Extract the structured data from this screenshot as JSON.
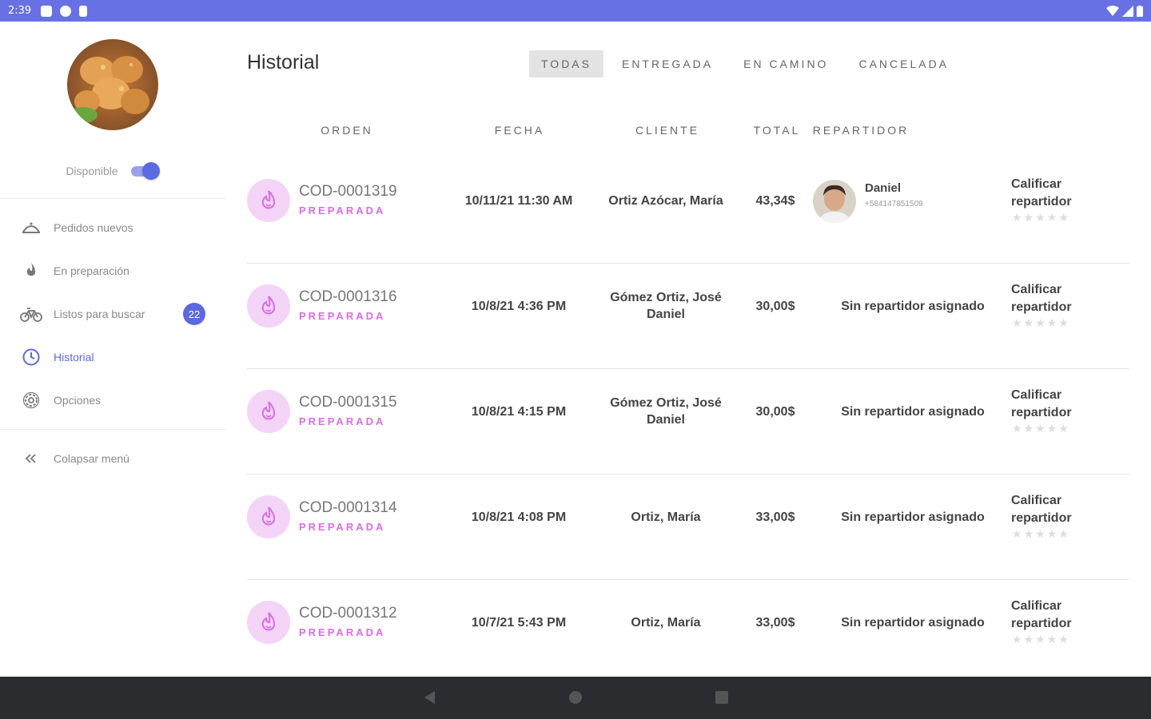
{
  "status_bar": {
    "time": "2:39"
  },
  "sidebar": {
    "availability_label": "Disponible",
    "availability_on": true,
    "items": [
      {
        "label": "Pedidos nuevos",
        "icon": "food-tray-icon"
      },
      {
        "label": "En preparación",
        "icon": "flame-icon"
      },
      {
        "label": "Listos para buscar",
        "icon": "bicycle-icon",
        "badge": "22"
      },
      {
        "label": "Historial",
        "icon": "clock-icon",
        "active": true
      },
      {
        "label": "Opciones",
        "icon": "gear-icon"
      }
    ],
    "collapse_label": "Colapsar menú"
  },
  "main": {
    "title": "Historial",
    "tabs": [
      {
        "label": "TODAS",
        "active": true
      },
      {
        "label": "ENTREGADA"
      },
      {
        "label": "EN CAMINO"
      },
      {
        "label": "CANCELADA"
      }
    ],
    "columns": [
      "ORDEN",
      "FECHA",
      "CLIENTE",
      "TOTAL",
      "REPARTIDOR"
    ],
    "rows": [
      {
        "code": "COD-0001319",
        "status": "PREPARADA",
        "date": "10/11/21 11:30 AM",
        "client": "Ortiz Azócar, María",
        "total": "43,34$",
        "driver_name": "Daniel",
        "driver_phone": "+584147851509",
        "driver_assigned": true,
        "rate_label": "Calificar repartidor"
      },
      {
        "code": "COD-0001316",
        "status": "PREPARADA",
        "date": "10/8/21 4:36 PM",
        "client": "Gómez Ortiz, José Daniel",
        "total": "30,00$",
        "driver_text": "Sin repartidor asignado",
        "driver_assigned": false,
        "rate_label": "Calificar repartidor"
      },
      {
        "code": "COD-0001315",
        "status": "PREPARADA",
        "date": "10/8/21 4:15 PM",
        "client": "Gómez Ortiz, José Daniel",
        "total": "30,00$",
        "driver_text": "Sin repartidor asignado",
        "driver_assigned": false,
        "rate_label": "Calificar repartidor"
      },
      {
        "code": "COD-0001314",
        "status": "PREPARADA",
        "date": "10/8/21 4:08 PM",
        "client": "Ortiz, María",
        "total": "33,00$",
        "driver_text": "Sin repartidor asignado",
        "driver_assigned": false,
        "rate_label": "Calificar repartidor"
      },
      {
        "code": "COD-0001312",
        "status": "PREPARADA",
        "date": "10/7/21 5:43 PM",
        "client": "Ortiz, María",
        "total": "33,00$",
        "driver_text": "Sin repartidor asignado",
        "driver_assigned": false,
        "rate_label": "Calificar repartidor"
      }
    ]
  },
  "colors": {
    "accent": "#5c6ae0",
    "status_bar": "#6771e3",
    "order_status": "#da6de6",
    "order_icon_bg": "#f3d4f7"
  }
}
